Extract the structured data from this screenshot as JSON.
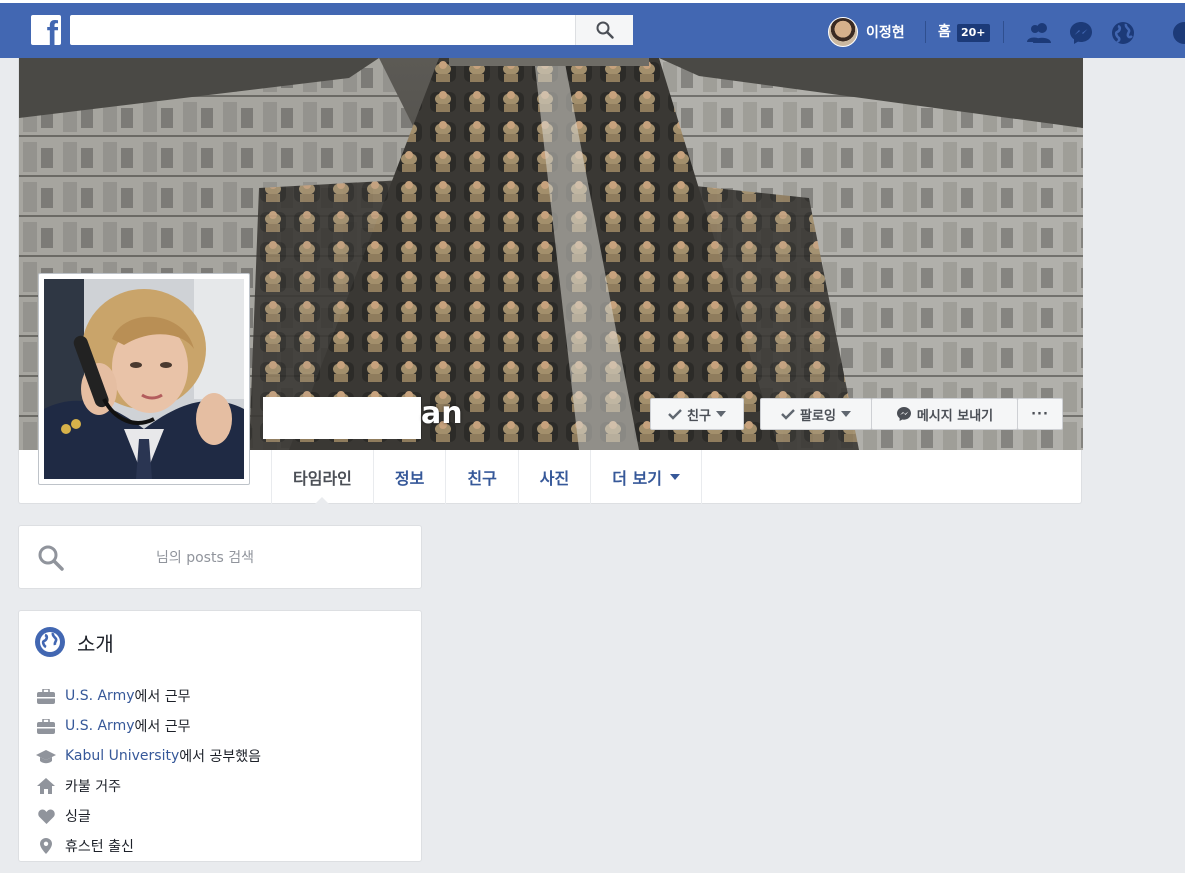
{
  "topbar": {
    "logo_letter": "f",
    "search_value": "",
    "user_name": "이정현",
    "home_label": "홈",
    "home_badge": "20+"
  },
  "cover": {
    "name_tail": "an",
    "buttons": {
      "friend_label": "친구",
      "following_label": "팔로잉",
      "message_label": "메시지 보내기",
      "more_label": "···"
    }
  },
  "tabs": [
    {
      "label": "타임라인",
      "active": true
    },
    {
      "label": "정보"
    },
    {
      "label": "친구"
    },
    {
      "label": "사진"
    },
    {
      "label": "더 보기"
    }
  ],
  "post_search": {
    "placeholder": "님의 posts 검색"
  },
  "intro": {
    "title": "소개",
    "items": [
      {
        "icon": "briefcase-icon",
        "link": "U.S. Army",
        "text": "에서 근무"
      },
      {
        "icon": "briefcase-icon",
        "link": "U.S. Army",
        "text": "에서 근무"
      },
      {
        "icon": "graduation-cap-icon",
        "link": "Kabul University",
        "text": "에서 공부했음"
      },
      {
        "icon": "home-icon",
        "link": "",
        "text": "카불 거주"
      },
      {
        "icon": "heart-icon",
        "link": "",
        "text": "싱글"
      },
      {
        "icon": "location-pin-icon",
        "link": "",
        "text": "휴스턴 출신"
      }
    ]
  },
  "colors": {
    "brand": "#4267b2",
    "link": "#365899",
    "background": "#e9ebee",
    "icon_gray": "#90949c"
  }
}
